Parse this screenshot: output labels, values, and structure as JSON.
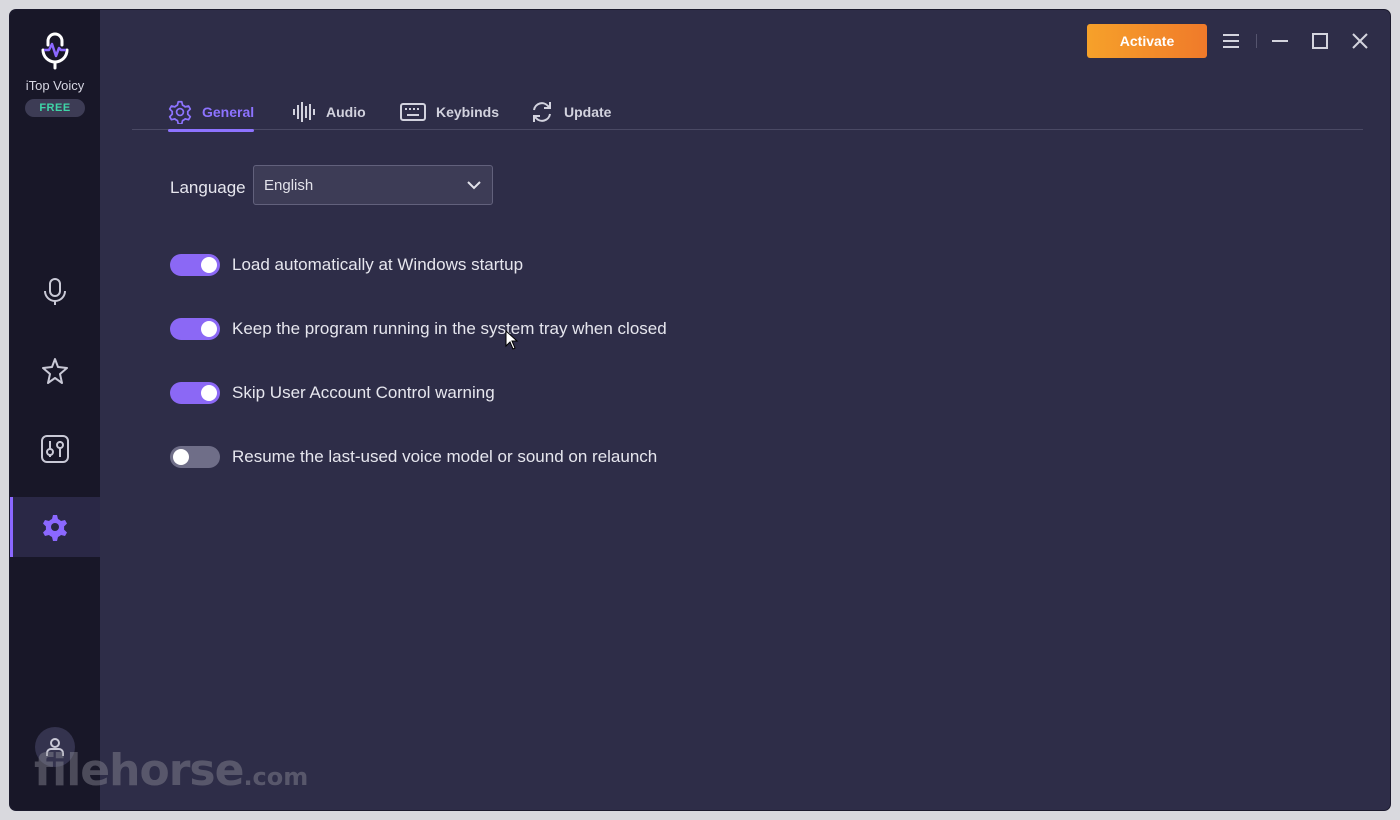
{
  "app": {
    "name": "iTop Voicy",
    "badge": "FREE"
  },
  "colors": {
    "accent": "#8b68ff",
    "activate": "#f08a2a",
    "window_bg": "#2e2d48",
    "sidebar_bg": "#181728",
    "badge_text": "#3fd6a8"
  },
  "sidebar": {
    "items": [
      {
        "name": "voice-changer",
        "icon": "microphone-icon",
        "active": false
      },
      {
        "name": "effects",
        "icon": "star-icon",
        "active": false
      },
      {
        "name": "soundboard",
        "icon": "sliders-icon",
        "active": false
      },
      {
        "name": "settings",
        "icon": "gear-icon",
        "active": true
      }
    ],
    "account_icon": "user-icon"
  },
  "watermark": {
    "brand": "filehorse",
    "suffix": ".com"
  },
  "topbar": {
    "activate_label": "Activate",
    "menu_icon": "hamburger-menu-icon",
    "minimize_icon": "minimize-icon",
    "maximize_icon": "maximize-icon",
    "close_icon": "close-icon"
  },
  "tabs": [
    {
      "label": "General",
      "icon": "gear-icon",
      "active": true
    },
    {
      "label": "Audio",
      "icon": "waveform-icon",
      "active": false
    },
    {
      "label": "Keybinds",
      "icon": "keyboard-icon",
      "active": false
    },
    {
      "label": "Update",
      "icon": "refresh-icon",
      "active": false
    }
  ],
  "general": {
    "language_label": "Language",
    "language_value": "English",
    "options": [
      {
        "label": "Load automatically at Windows startup",
        "enabled": true
      },
      {
        "label": "Keep the program running in the system tray when closed",
        "enabled": true
      },
      {
        "label": "Skip User Account Control warning",
        "enabled": true
      },
      {
        "label": "Resume the last-used voice model or sound on relaunch",
        "enabled": false
      }
    ]
  }
}
